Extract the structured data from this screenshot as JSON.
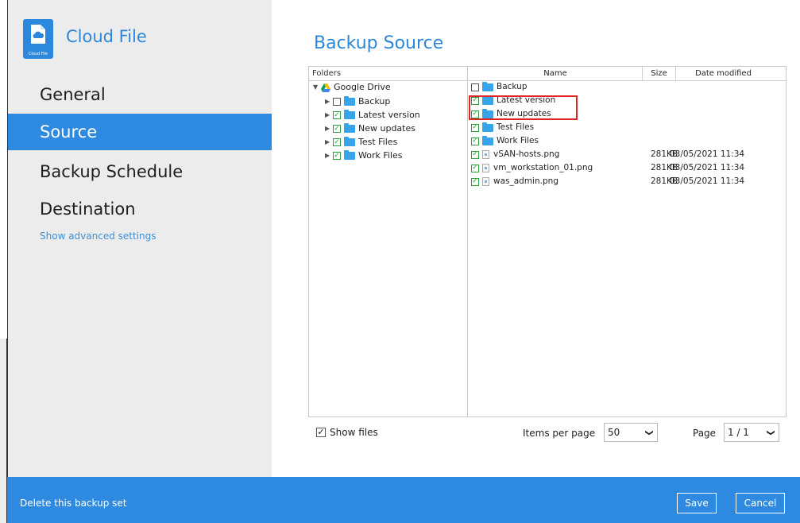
{
  "app": {
    "title": "Cloud File",
    "logo_text": "Cloud File"
  },
  "sidebar": {
    "items": [
      {
        "label": "General",
        "active": false
      },
      {
        "label": "Source",
        "active": true
      },
      {
        "label": "Backup Schedule",
        "active": false
      },
      {
        "label": "Destination",
        "active": false
      }
    ],
    "advanced_link": "Show advanced settings"
  },
  "main": {
    "title": "Backup Source",
    "folders": {
      "header": "Folders",
      "root": "Google Drive",
      "children": [
        {
          "label": "Backup",
          "checked": false
        },
        {
          "label": "Latest version",
          "checked": true
        },
        {
          "label": "New updates",
          "checked": true
        },
        {
          "label": "Test Files",
          "checked": true
        },
        {
          "label": "Work Files",
          "checked": true
        }
      ]
    },
    "files": {
      "columns": [
        "Name",
        "Size",
        "Date modified"
      ],
      "rows": [
        {
          "name": "Backup",
          "type": "folder",
          "checked": false,
          "size": "",
          "date": ""
        },
        {
          "name": "Latest version",
          "type": "folder",
          "checked": true,
          "size": "",
          "date": ""
        },
        {
          "name": "New updates",
          "type": "folder",
          "checked": true,
          "size": "",
          "date": ""
        },
        {
          "name": "Test Files",
          "type": "folder",
          "checked": true,
          "size": "",
          "date": ""
        },
        {
          "name": "Work Files",
          "type": "folder",
          "checked": true,
          "size": "",
          "date": ""
        },
        {
          "name": "vSAN-hosts.png",
          "type": "file",
          "checked": true,
          "size": "281KB",
          "date": "03/05/2021 11:34"
        },
        {
          "name": "vm_workstation_01.png",
          "type": "file",
          "checked": true,
          "size": "281KB",
          "date": "03/05/2021 11:34"
        },
        {
          "name": "was_admin.png",
          "type": "file",
          "checked": true,
          "size": "281KB",
          "date": "03/05/2021 11:34"
        }
      ]
    },
    "show_files": {
      "label": "Show files",
      "checked": true
    },
    "items_per_page": {
      "label": "Items per page",
      "value": "50"
    },
    "page": {
      "label": "Page",
      "value": "1 / 1"
    }
  },
  "footer": {
    "delete_link": "Delete this backup set",
    "save_label": "Save",
    "cancel_label": "Cancel"
  },
  "colors": {
    "accent": "#2d8ae0",
    "highlight_box": "#e02424",
    "check_green": "#2d9e3a"
  }
}
